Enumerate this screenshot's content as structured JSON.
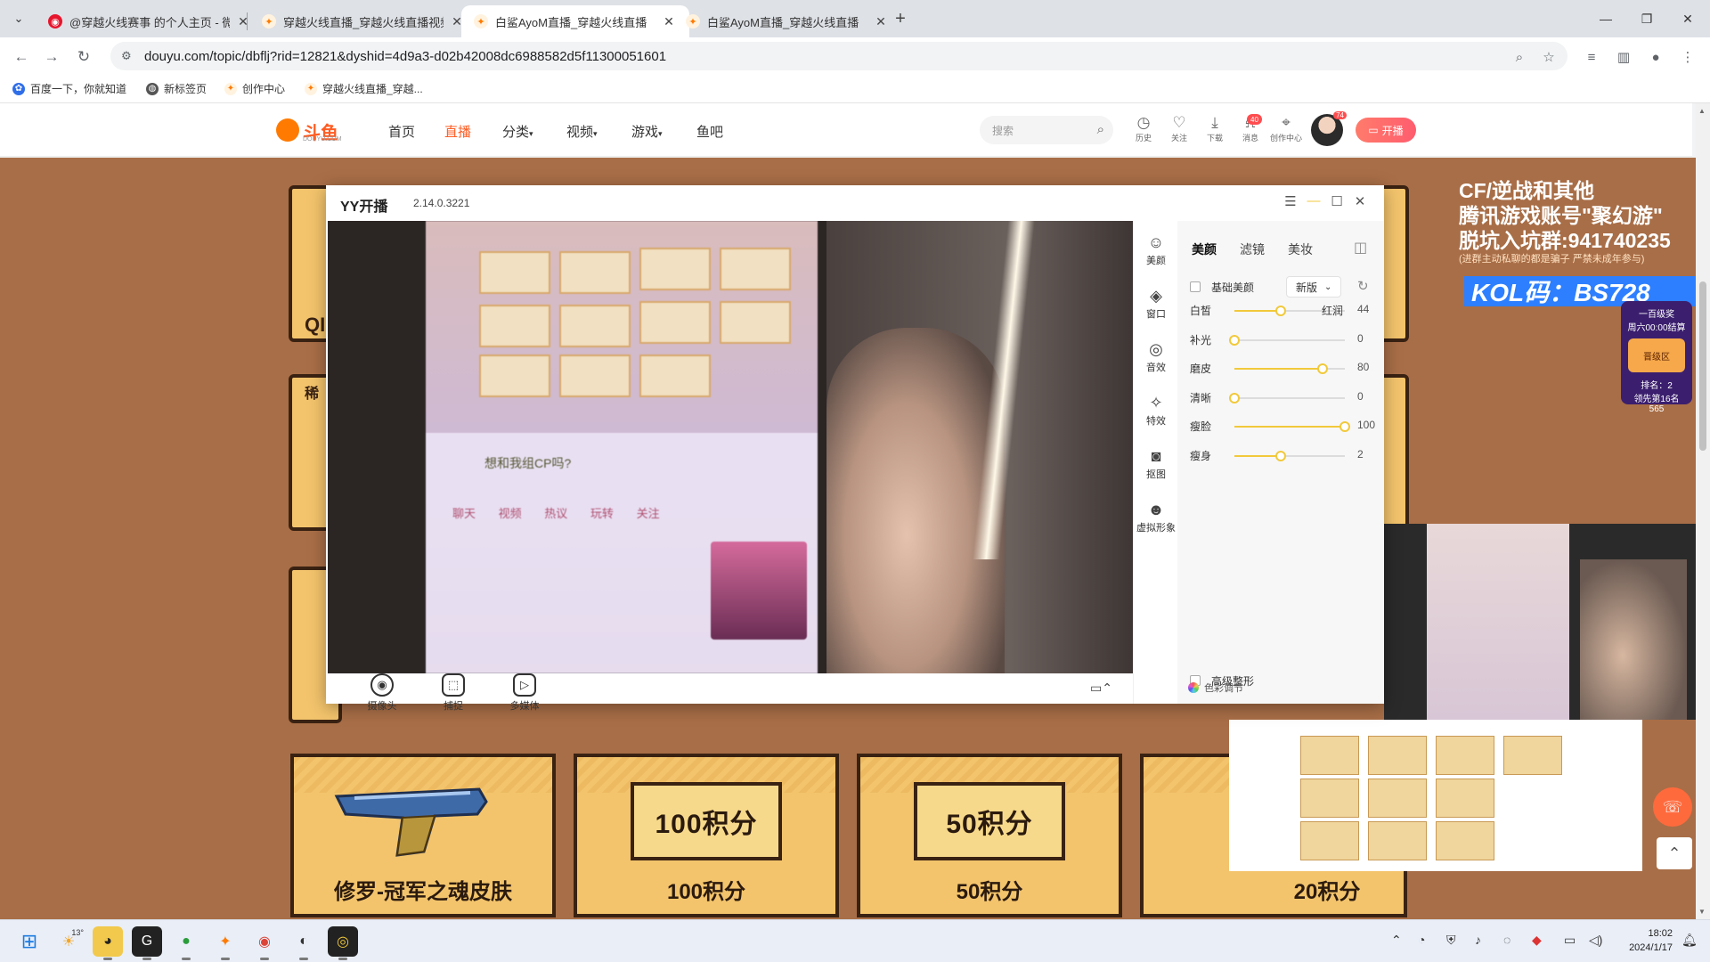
{
  "browser": {
    "tabs": [
      {
        "title": "@穿越火线赛事 的个人主页 - 微博",
        "active": false
      },
      {
        "title": "穿越火线直播_穿越火线直播视频",
        "active": false
      },
      {
        "title": "白鲨AyoM直播_穿越火线直播",
        "active": true
      },
      {
        "title": "白鲨AyoM直播_穿越火线直播",
        "active": false
      }
    ],
    "url": "douyu.com/topic/dbflj?rid=12821&dyshid=4d9a3-d02b42008dc6988582d5f11300051601",
    "bookmarks": [
      "百度一下，你就知道",
      "新标签页",
      "创作中心",
      "穿越火线直播_穿越..."
    ]
  },
  "douyu": {
    "logo": "斗鱼",
    "logo_sub": "DOUYU.COM",
    "nav": [
      "首页",
      "直播",
      "分类",
      "视频",
      "游戏",
      "鱼吧"
    ],
    "active_nav": "直播",
    "search_placeholder": "搜索",
    "icons": [
      "历史",
      "关注",
      "下载",
      "消息",
      "创作中心"
    ],
    "message_badge": "40",
    "avatar_level": "74",
    "kaibo": "开播"
  },
  "event": {
    "prizes": [
      "修罗-冠军之魂皮肤",
      "100积分",
      "50积分",
      "20积分"
    ],
    "prize_boxes": [
      "100积分",
      "50积分"
    ],
    "side_card_labels": [
      "QI",
      "稀"
    ],
    "ad_lines": [
      "CF/逆战和其他",
      "腾讯游戏账号\"聚幻游\"",
      "脱坑入坑群:941740235"
    ],
    "ad_small": "(进群主动私聊的都是骗子 严禁未成年参与)",
    "kol": "KOL码：BS728",
    "rank": {
      "title": "一百级奖",
      "sub": "周六00:00结算",
      "button": "晋级区",
      "rank": "排名：2",
      "lead": "领先第16名",
      "score": "565"
    }
  },
  "yy": {
    "app_name": "YY开播",
    "version": "2.14.0.3221",
    "tools": [
      "摄像头",
      "捕捉",
      "多媒体"
    ],
    "side_menu": [
      "美颜",
      "窗口",
      "音效",
      "特效",
      "抠图",
      "虚拟形象"
    ],
    "panel_tabs": [
      "美颜",
      "滤镜",
      "美妆"
    ],
    "basic_beauty_label": "基础美颜",
    "version_select": "新版",
    "sliders": [
      {
        "label": "白皙",
        "right_label": "红润",
        "value": 44,
        "fraction": 0.42
      },
      {
        "label": "补光",
        "right_label": "",
        "value": 0,
        "fraction": 0.0
      },
      {
        "label": "磨皮",
        "right_label": "",
        "value": 80,
        "fraction": 0.8
      },
      {
        "label": "清晰",
        "right_label": "",
        "value": 0,
        "fraction": 0.0
      },
      {
        "label": "瘦脸",
        "right_label": "",
        "value": 100,
        "fraction": 1.0
      },
      {
        "label": "瘦身",
        "right_label": "",
        "value": 2,
        "fraction": 0.42
      }
    ],
    "advanced_label": "高级整形",
    "color_adjust": "色彩调节",
    "phone_chat_title": "想和我组CP吗?",
    "phone_tabs": [
      "聊天",
      "视频",
      "热议",
      "玩转",
      "关注"
    ]
  },
  "taskbar": {
    "weather": "13°",
    "time": "18:02",
    "date": "2024/1/17"
  },
  "colors": {
    "douyu_orange": "#ff5d23",
    "page_bg": "#a86e47",
    "card": "#f3c46c",
    "kol_blue": "#2d7fff"
  }
}
